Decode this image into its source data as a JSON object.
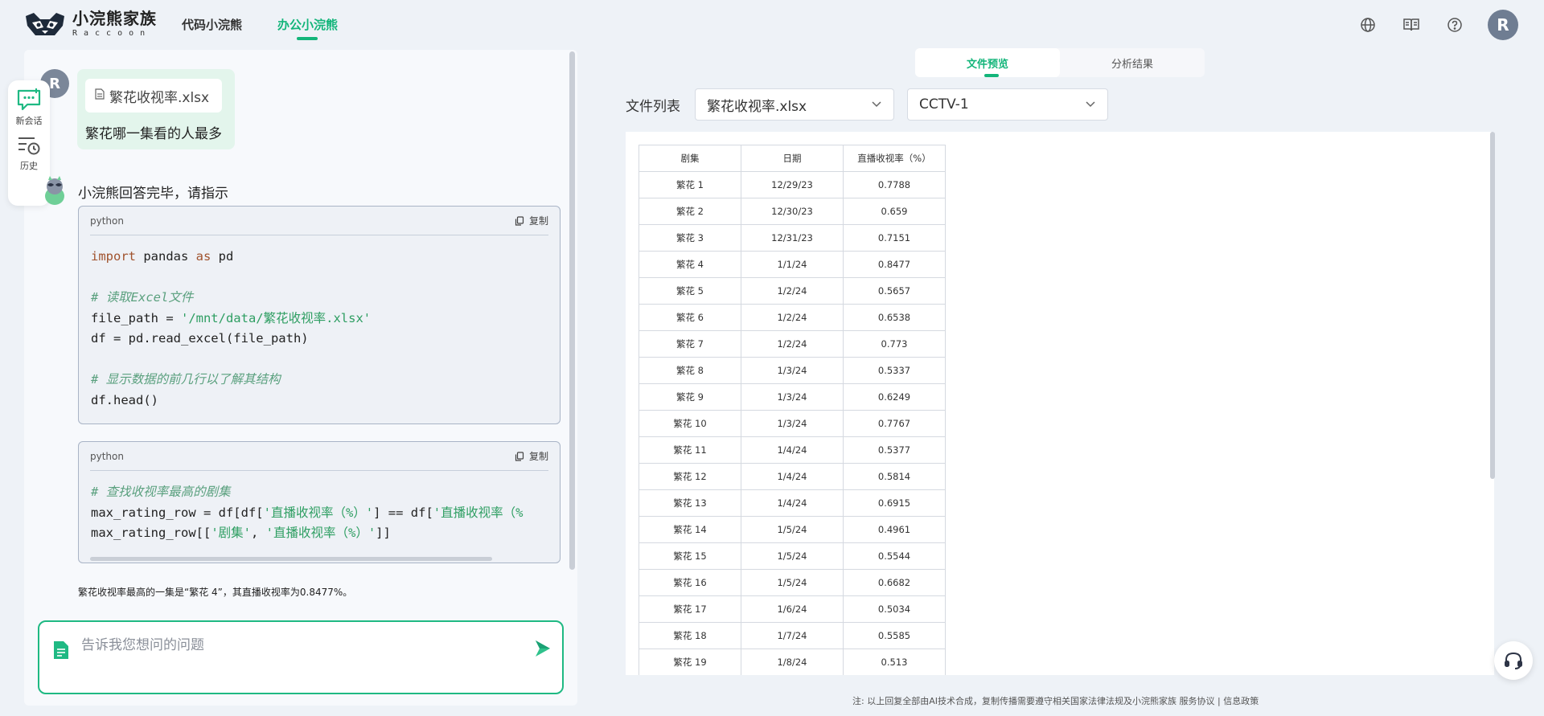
{
  "brand": {
    "title": "小浣熊家族",
    "subtitle": "Raccoon"
  },
  "nav": [
    {
      "label": "代码小浣熊",
      "active": false
    },
    {
      "label": "办公小浣熊",
      "active": true
    }
  ],
  "header_icons": [
    "globe-icon",
    "book-icon",
    "help-icon"
  ],
  "user_initial": "R",
  "side_tools": {
    "new_chat": "新会话",
    "history": "历史"
  },
  "chat": {
    "user_file": "繁花收视率.xlsx",
    "user_question": "繁花哪一集看的人最多",
    "bot_status": "小浣熊回答完毕，请指示",
    "code_blocks": [
      {
        "lang": "python",
        "copy_label": "复制"
      },
      {
        "lang": "python",
        "copy_label": "复制"
      }
    ],
    "code1": {
      "l1_kw": "import",
      "l1_a": " pandas ",
      "l1_kw2": "as",
      "l1_b": " pd",
      "c1": "# 读取Excel文件",
      "l2_a": "file_path = ",
      "l2_s": "'/mnt/data/繁花收视率.xlsx'",
      "l3": "df = pd.read_excel(file_path)",
      "c2": "# 显示数据的前几行以了解其结构",
      "l4": "df.head()"
    },
    "code2": {
      "c1": "# 查找收视率最高的剧集",
      "l1_a": "max_rating_row = df[df[",
      "l1_s": "'直播收视率（%）'",
      "l1_b": "] == df[",
      "l1_s2": "'直播收视率（%",
      "l2_a": "max_rating_row[[",
      "l2_s": "'剧集'",
      "l2_b": ", ",
      "l2_s2": "'直播收视率（%）'",
      "l2_c": "]]"
    },
    "answer": "繁花收视率最高的一集是“繁花 4”，其直播收视率为0.8477%。",
    "input_placeholder": "告诉我您想问的问题"
  },
  "tabs": [
    {
      "label": "文件预览",
      "active": true
    },
    {
      "label": "分析结果",
      "active": false
    }
  ],
  "file_list_label": "文件列表",
  "file_select": "繁花收视率.xlsx",
  "sheet_select": "CCTV-1",
  "table": {
    "headers": [
      "剧集",
      "日期",
      "直播收视率（%）"
    ],
    "rows": [
      [
        "繁花 1",
        "12/29/23",
        "0.7788"
      ],
      [
        "繁花 2",
        "12/30/23",
        "0.659"
      ],
      [
        "繁花 3",
        "12/31/23",
        "0.7151"
      ],
      [
        "繁花 4",
        "1/1/24",
        "0.8477"
      ],
      [
        "繁花 5",
        "1/2/24",
        "0.5657"
      ],
      [
        "繁花 6",
        "1/2/24",
        "0.6538"
      ],
      [
        "繁花 7",
        "1/2/24",
        "0.773"
      ],
      [
        "繁花 8",
        "1/3/24",
        "0.5337"
      ],
      [
        "繁花 9",
        "1/3/24",
        "0.6249"
      ],
      [
        "繁花 10",
        "1/3/24",
        "0.7767"
      ],
      [
        "繁花 11",
        "1/4/24",
        "0.5377"
      ],
      [
        "繁花 12",
        "1/4/24",
        "0.5814"
      ],
      [
        "繁花 13",
        "1/4/24",
        "0.6915"
      ],
      [
        "繁花 14",
        "1/5/24",
        "0.4961"
      ],
      [
        "繁花 15",
        "1/5/24",
        "0.5544"
      ],
      [
        "繁花 16",
        "1/5/24",
        "0.6682"
      ],
      [
        "繁花 17",
        "1/6/24",
        "0.5034"
      ],
      [
        "繁花 18",
        "1/7/24",
        "0.5585"
      ],
      [
        "繁花 19",
        "1/8/24",
        "0.513"
      ]
    ]
  },
  "footer": {
    "note": "注: 以上回复全部由AI技术合成，复制传播需要遵守相关国家法律法规及小浣熊家族",
    "service": "服务协议",
    "sep": "|",
    "privacy": "信息政策"
  },
  "colors": {
    "accent": "#13b57a",
    "bubble": "#e3f5ec",
    "code_bg": "#eef1f6"
  }
}
